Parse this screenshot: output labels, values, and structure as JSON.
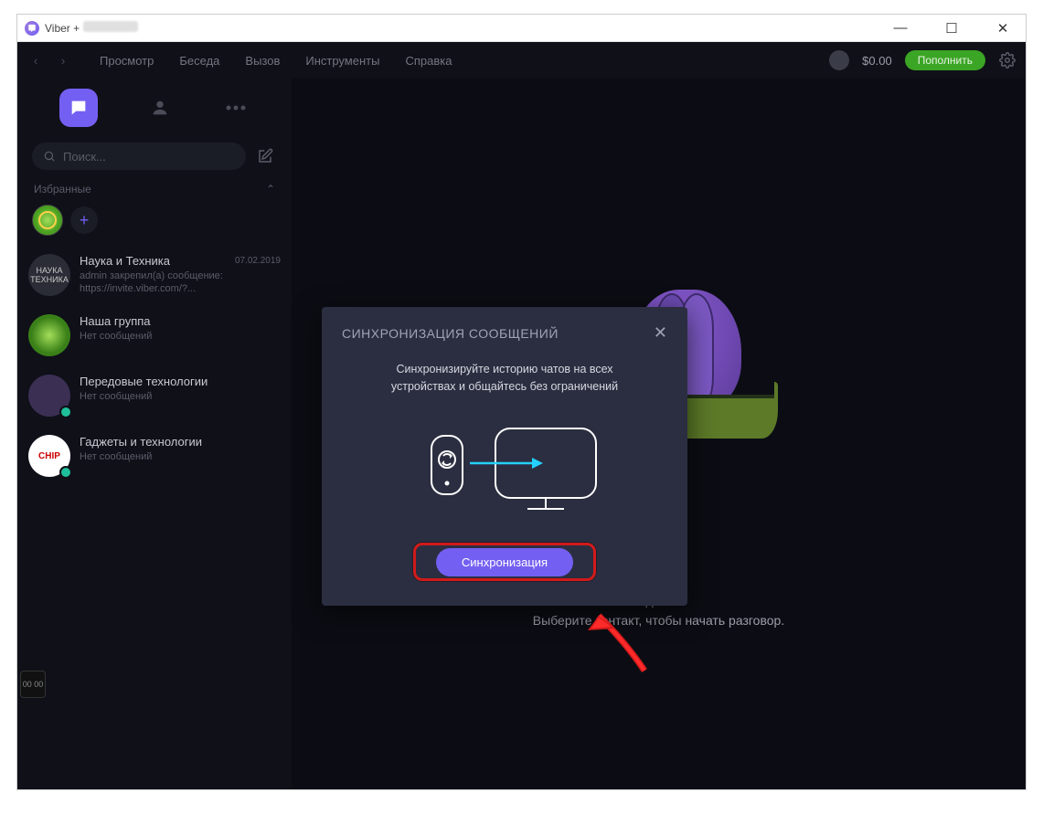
{
  "window": {
    "title_prefix": "Viber +"
  },
  "win_controls": {
    "min": "—",
    "max": "☐",
    "close": "✕"
  },
  "topbar": {
    "menus": [
      "Просмотр",
      "Беседа",
      "Вызов",
      "Инструменты",
      "Справка"
    ],
    "balance": "$0.00",
    "topup_label": "Пополнить"
  },
  "sidebar": {
    "search_placeholder": "Поиск...",
    "section_label": "Избранные",
    "fav_add": "+",
    "chats": [
      {
        "title": "Наука и Техника",
        "sub1": "admin закрепил(а) сообщение:",
        "sub2": "https://invite.viber.com/?...",
        "date": "07.02.2019",
        "avatar": "НАУКА\nТЕХНИКА",
        "avclass": ""
      },
      {
        "title": "Наша группа",
        "sub1": "Нет сообщений",
        "sub2": "",
        "date": "",
        "avatar": "",
        "avclass": "av-green"
      },
      {
        "title": "Передовые технологии",
        "sub1": "Нет сообщений",
        "sub2": "",
        "date": "",
        "avatar": "",
        "avclass": "av-tech"
      },
      {
        "title": "Гаджеты и технологии",
        "sub1": "Нет сообщений",
        "sub2": "",
        "date": "",
        "avatar": "CHIP",
        "avclass": "av-chip"
      }
    ]
  },
  "main": {
    "empty_line1": "здесь.",
    "empty_line2": "Выберите контакт, чтобы начать разговор."
  },
  "modal": {
    "title": "СИНХРОНИЗАЦИЯ СООБЩЕНИЙ",
    "close": "✕",
    "text_line1": "Синхронизируйте историю чатов на всех",
    "text_line2": "устройствах и общайтесь без ограничений",
    "button": "Синхронизация"
  },
  "side_tiny": "00\n00"
}
